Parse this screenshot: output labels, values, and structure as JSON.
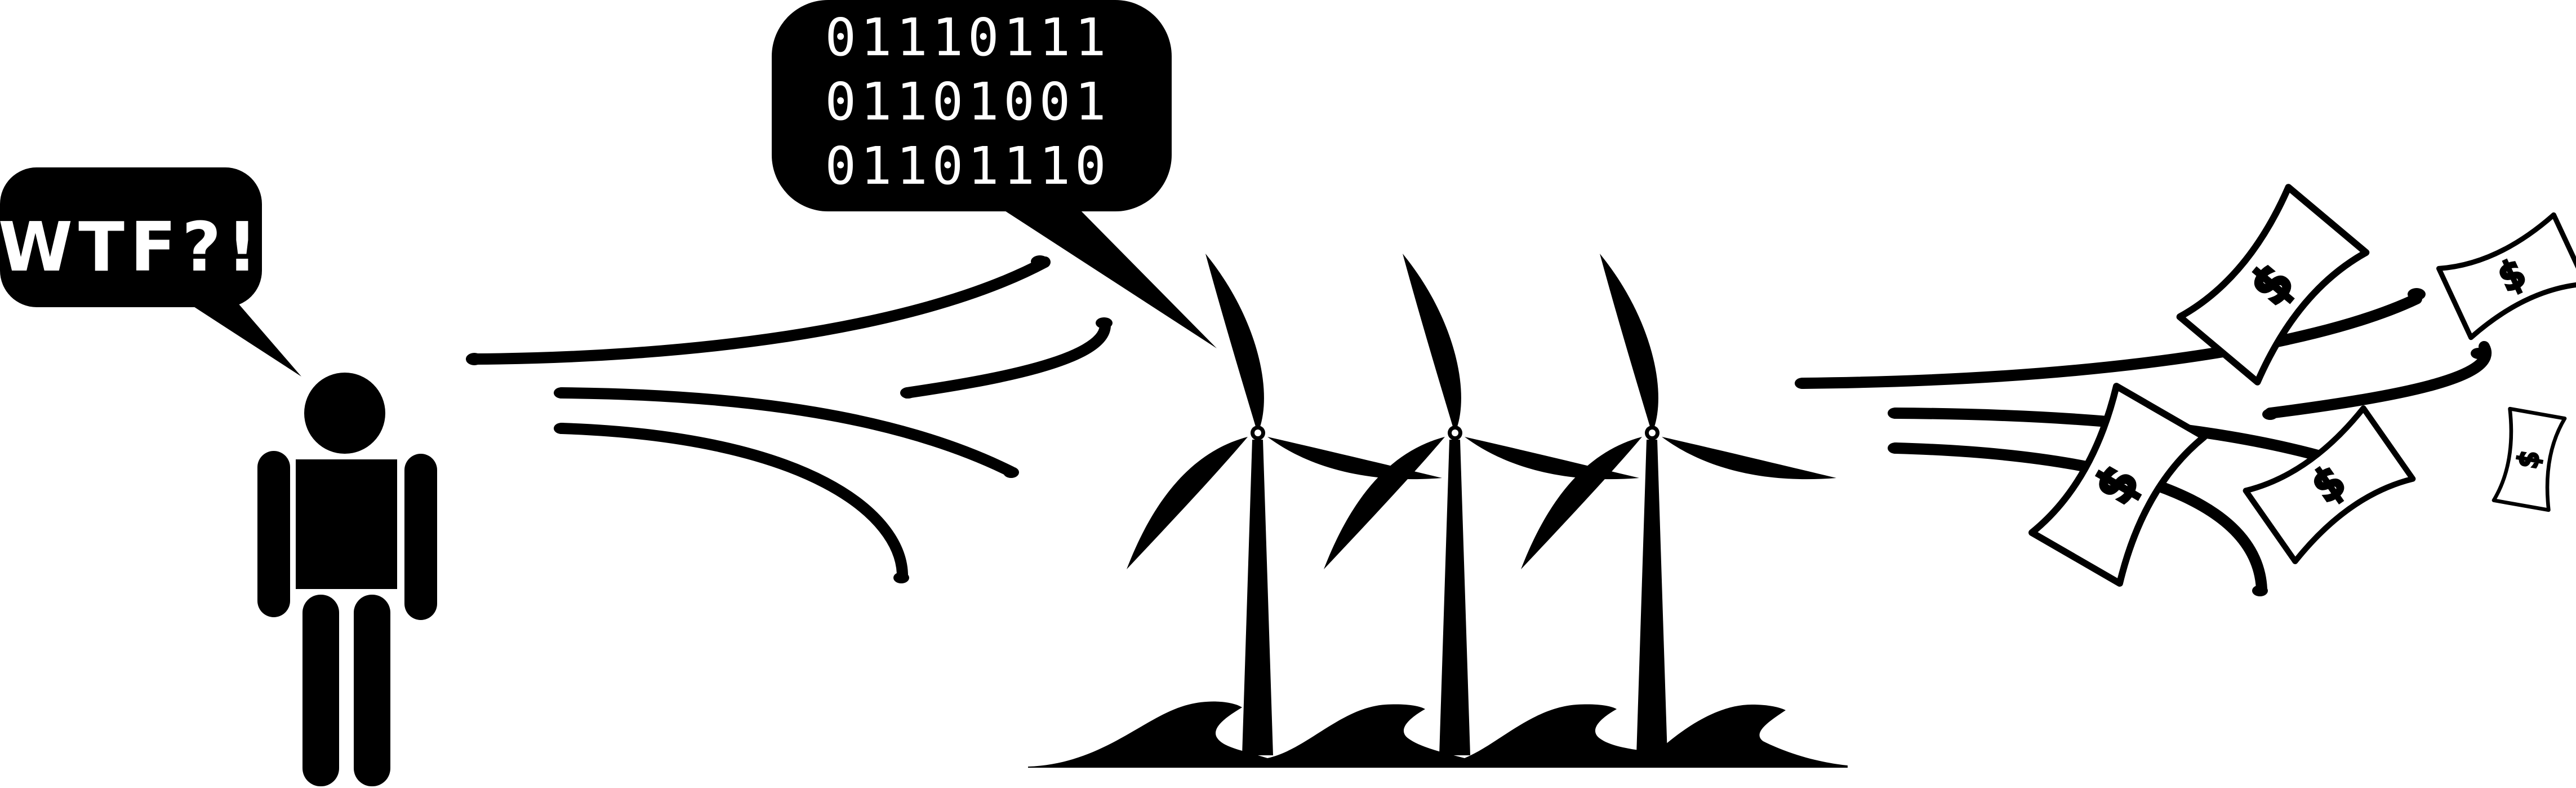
{
  "speech": {
    "person_text": "WTF?!",
    "binary_lines": [
      "01110111",
      "01101001",
      "01101110"
    ]
  },
  "colors": {
    "ink": "#000000",
    "paper": "#ffffff"
  },
  "icons": [
    "person-figure-icon",
    "speech-bubble-icon",
    "wind-gust-icon",
    "wind-turbine-icon",
    "water-wave-icon",
    "dollar-bill-icon"
  ]
}
